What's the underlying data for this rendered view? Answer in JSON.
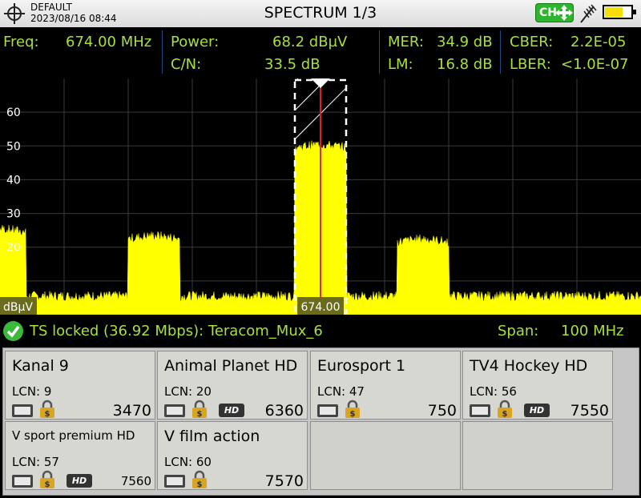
{
  "header": {
    "profile": "DEFAULT",
    "datetime": "2023/08/16 08:44",
    "title": "SPECTRUM 1/3",
    "ch_label": "CH",
    "icons": [
      "target-icon",
      "ch-move-icon",
      "antenna-icon",
      "battery-icon"
    ],
    "battery_level": 0.7
  },
  "measurements": {
    "freq_label": "Freq:",
    "freq_value": "674.00 MHz",
    "power_label": "Power:",
    "power_value": "68.2 dBµV",
    "cn_label": "C/N:",
    "cn_value": "33.5 dB",
    "mer_label": "MER:",
    "mer_value": "34.9 dB",
    "lm_label": "LM:",
    "lm_value": "16.8 dB",
    "cber_label": "CBER:",
    "cber_value": "2.2E-05",
    "lber_label": "LBER:",
    "lber_value": "<1.0E-07"
  },
  "colors": {
    "accent": "#a8e03c",
    "spectrum": "#ffff00",
    "marker": "#e02020",
    "grid": "#3a3a3a"
  },
  "chart_data": {
    "type": "area",
    "ylabel": "dBµV",
    "y_ticks": [
      "20",
      "30",
      "40",
      "50",
      "60"
    ],
    "ylim": [
      0,
      70
    ],
    "x_span_mhz": 100,
    "center_mhz": 674,
    "marker_label": "674.00",
    "channels": [
      {
        "center_mhz": 624,
        "bandwidth_mhz": 8,
        "level": 25
      },
      {
        "center_mhz": 648,
        "bandwidth_mhz": 8,
        "level": 23
      },
      {
        "center_mhz": 674,
        "bandwidth_mhz": 8,
        "level": 50
      },
      {
        "center_mhz": 690,
        "bandwidth_mhz": 8,
        "level": 22
      }
    ],
    "noise_floor": 4
  },
  "status": {
    "ts_text": "TS locked (36.92 Mbps): Teracom_Mux_6",
    "span_label": "Span:",
    "span_value": "100 MHz"
  },
  "services": [
    {
      "name": "Kanal 9",
      "lcn": "LCN: 9",
      "sid": "3470",
      "hd": false
    },
    {
      "name": "Animal Planet HD",
      "lcn": "LCN: 20",
      "sid": "6360",
      "hd": true
    },
    {
      "name": "Eurosport 1",
      "lcn": "LCN: 47",
      "sid": "750",
      "hd": false
    },
    {
      "name": "TV4 Hockey HD",
      "lcn": "LCN: 56",
      "sid": "7550",
      "hd": true
    },
    {
      "name": "V sport premium HD",
      "lcn": "LCN: 57",
      "sid": "7560",
      "hd": true
    },
    {
      "name": "V film action",
      "lcn": "LCN: 60",
      "sid": "7570",
      "hd": false
    }
  ],
  "hd_badge": "HD"
}
